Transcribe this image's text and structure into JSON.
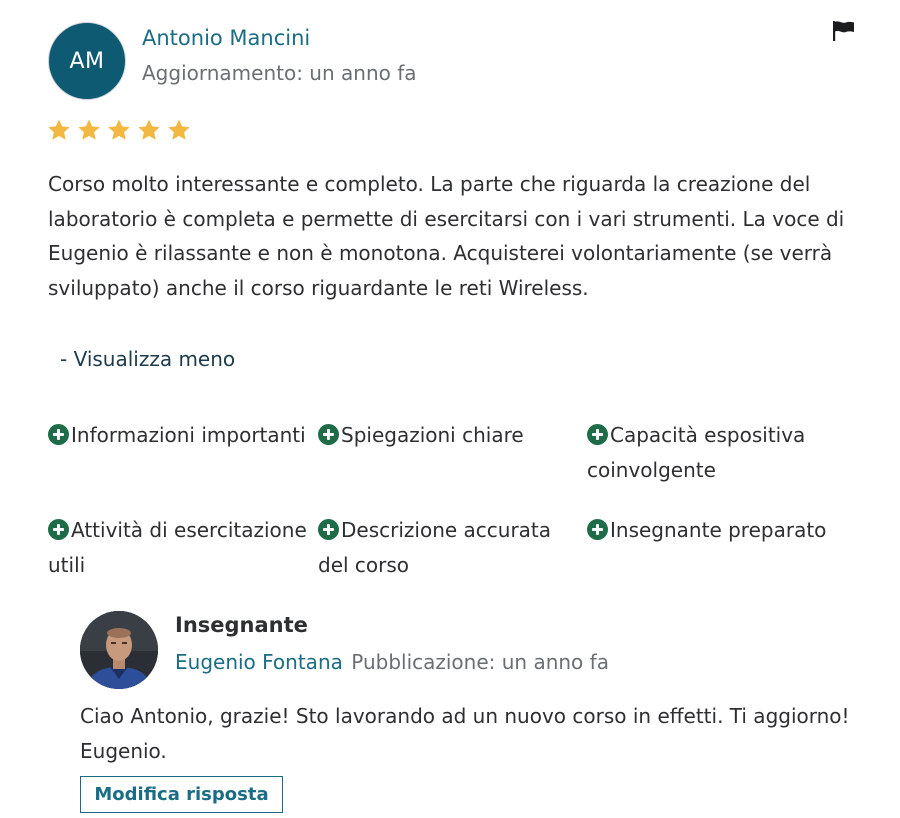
{
  "reviewer": {
    "initials": "AM",
    "name": "Antonio Mancini",
    "updated": "Aggiornamento: un anno fa",
    "avatar_color": "#0f5a73"
  },
  "rating": {
    "value": 5,
    "max": 5,
    "star_color": "#f3b842"
  },
  "review": {
    "text": "Corso molto interessante e completo. La parte che riguarda la creazione del laboratorio è completa e permette di esercitarsi con i vari strumenti. La voce di Eugenio è rilassante e non è monotona. Acquisterei volontariamente (se verrà sviluppato) anche il corso riguardante le reti Wireless.",
    "show_less": "- Visualizza meno"
  },
  "tags": [
    "Informazioni importanti",
    "Spiegazioni chiare",
    "Capacità espositiva coinvolgente",
    "Attività di esercitazione utili",
    "Descrizione accurata del corso",
    "Insegnante preparato"
  ],
  "response": {
    "role": "Insegnante",
    "instructor_name": "Eugenio Fontana",
    "published": "Pubblicazione: un anno fa",
    "text": "Ciao Antonio, grazie! Sto lavorando ad un nuovo corso in effetti. Ti aggiorno! Eugenio.",
    "edit_label": "Modifica risposta"
  },
  "icons": {
    "flag": "flag-icon",
    "star": "star-icon",
    "tag": "plus-circle-icon"
  },
  "colors": {
    "link": "#1b6d85",
    "tag_icon": "#1e6b48",
    "text": "#2d2f31",
    "muted": "#6a6f73"
  }
}
